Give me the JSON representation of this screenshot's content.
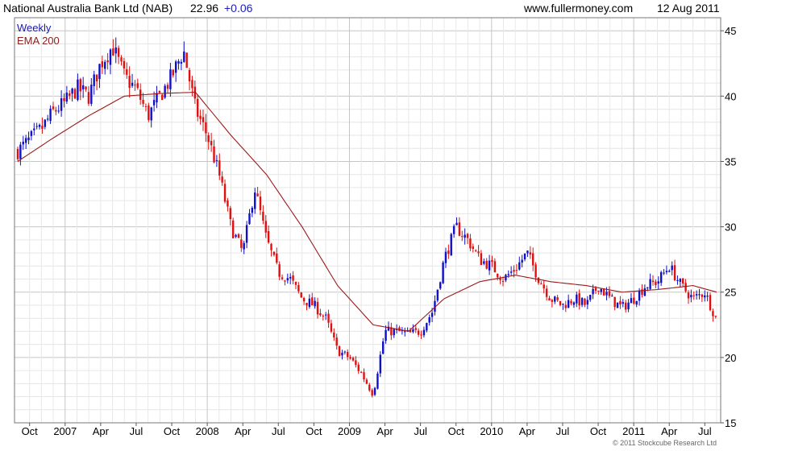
{
  "header": {
    "title": "National Australia Bank Ltd (NAB)",
    "price": "22.96",
    "change": "+0.06",
    "site": "www.fullermoney.com",
    "date": "12 Aug 2011"
  },
  "legend": {
    "period": "Weekly",
    "ema": "EMA 200"
  },
  "copyright": "© 2011 Stockcube Research Ltd",
  "colors": {
    "up": "#1010c8",
    "down": "#e01010",
    "ema": "#9a1a1a",
    "period_label": "#1a1aaa",
    "ema_label": "#8b2020",
    "grid": "#d0d0d0"
  },
  "chart_data": {
    "type": "candlestick",
    "title": "National Australia Bank Ltd (NAB)",
    "xlabel": "",
    "ylabel": "",
    "ylim": [
      15,
      46
    ],
    "yticks": [
      15,
      20,
      25,
      30,
      35,
      40,
      45
    ],
    "x_start": "2006-09",
    "x_end": "2011-08",
    "grid": true,
    "legend_position": "top-left",
    "x_ticks": [
      {
        "label": "Oct",
        "date": "2006-10"
      },
      {
        "label": "2007",
        "date": "2007-01"
      },
      {
        "label": "Apr",
        "date": "2007-04"
      },
      {
        "label": "Jul",
        "date": "2007-07"
      },
      {
        "label": "Oct",
        "date": "2007-10"
      },
      {
        "label": "2008",
        "date": "2008-01"
      },
      {
        "label": "Apr",
        "date": "2008-04"
      },
      {
        "label": "Jul",
        "date": "2008-07"
      },
      {
        "label": "Oct",
        "date": "2008-10"
      },
      {
        "label": "2009",
        "date": "2009-01"
      },
      {
        "label": "Apr",
        "date": "2009-04"
      },
      {
        "label": "Jul",
        "date": "2009-07"
      },
      {
        "label": "Oct",
        "date": "2009-10"
      },
      {
        "label": "2010",
        "date": "2010-01"
      },
      {
        "label": "Apr",
        "date": "2010-04"
      },
      {
        "label": "Jul",
        "date": "2010-07"
      },
      {
        "label": "Oct",
        "date": "2010-10"
      },
      {
        "label": "2011",
        "date": "2011-01"
      },
      {
        "label": "Apr",
        "date": "2011-04"
      },
      {
        "label": "Jul",
        "date": "2011-07"
      }
    ],
    "price_path": [
      [
        "2006-09",
        35.8
      ],
      [
        "2006-11",
        37.5
      ],
      [
        "2006-12",
        38.8
      ],
      [
        "2007-01",
        39.5
      ],
      [
        "2007-02",
        40.6
      ],
      [
        "2007-03",
        40.0
      ],
      [
        "2007-04",
        42.5
      ],
      [
        "2007-05",
        43.8
      ],
      [
        "2007-06",
        41.5
      ],
      [
        "2007-07",
        40.5
      ],
      [
        "2007-08",
        38.5
      ],
      [
        "2007-09",
        40.0
      ],
      [
        "2007-10",
        41.5
      ],
      [
        "2007-11",
        43.5
      ],
      [
        "2007-12",
        39.0
      ],
      [
        "2008-01",
        37.0
      ],
      [
        "2008-02",
        34.0
      ],
      [
        "2008-03",
        30.0
      ],
      [
        "2008-04",
        28.0
      ],
      [
        "2008-05",
        33.0
      ],
      [
        "2008-06",
        29.0
      ],
      [
        "2008-07",
        26.5
      ],
      [
        "2008-08",
        26.0
      ],
      [
        "2008-09",
        24.5
      ],
      [
        "2008-10",
        24.0
      ],
      [
        "2008-11",
        23.0
      ],
      [
        "2008-12",
        20.5
      ],
      [
        "2009-01",
        20.0
      ],
      [
        "2009-02",
        18.8
      ],
      [
        "2009-03",
        17.2
      ],
      [
        "2009-04",
        22.0
      ],
      [
        "2009-05",
        22.0
      ],
      [
        "2009-06",
        21.8
      ],
      [
        "2009-07",
        22.0
      ],
      [
        "2009-08",
        23.5
      ],
      [
        "2009-09",
        27.5
      ],
      [
        "2009-10",
        30.0
      ],
      [
        "2009-11",
        29.0
      ],
      [
        "2009-12",
        27.5
      ],
      [
        "2010-01",
        27.0
      ],
      [
        "2010-02",
        26.0
      ],
      [
        "2010-03",
        26.8
      ],
      [
        "2010-04",
        28.0
      ],
      [
        "2010-05",
        26.0
      ],
      [
        "2010-06",
        24.5
      ],
      [
        "2010-07",
        24.0
      ],
      [
        "2010-08",
        24.5
      ],
      [
        "2010-09",
        24.0
      ],
      [
        "2010-10",
        25.5
      ],
      [
        "2010-11",
        24.5
      ],
      [
        "2010-12",
        23.8
      ],
      [
        "2011-01",
        24.5
      ],
      [
        "2011-02",
        25.5
      ],
      [
        "2011-03",
        25.8
      ],
      [
        "2011-04",
        27.0
      ],
      [
        "2011-05",
        25.5
      ],
      [
        "2011-06",
        24.5
      ],
      [
        "2011-07",
        25.0
      ],
      [
        "2011-08",
        22.9
      ]
    ],
    "ema_path": [
      [
        "2006-09",
        35.0
      ],
      [
        "2006-12",
        36.8
      ],
      [
        "2007-03",
        38.5
      ],
      [
        "2007-06",
        40.0
      ],
      [
        "2007-09",
        40.2
      ],
      [
        "2007-12",
        40.3
      ],
      [
        "2008-03",
        37.0
      ],
      [
        "2008-06",
        34.0
      ],
      [
        "2008-09",
        30.0
      ],
      [
        "2008-12",
        25.5
      ],
      [
        "2009-03",
        22.5
      ],
      [
        "2009-06",
        22.0
      ],
      [
        "2009-09",
        24.5
      ],
      [
        "2009-12",
        25.8
      ],
      [
        "2010-03",
        26.3
      ],
      [
        "2010-06",
        25.8
      ],
      [
        "2010-09",
        25.5
      ],
      [
        "2010-12",
        25.0
      ],
      [
        "2011-03",
        25.2
      ],
      [
        "2011-06",
        25.5
      ],
      [
        "2011-08",
        25.0
      ]
    ],
    "series": [
      {
        "name": "Weekly",
        "kind": "candlestick"
      },
      {
        "name": "EMA 200",
        "kind": "line"
      }
    ]
  }
}
